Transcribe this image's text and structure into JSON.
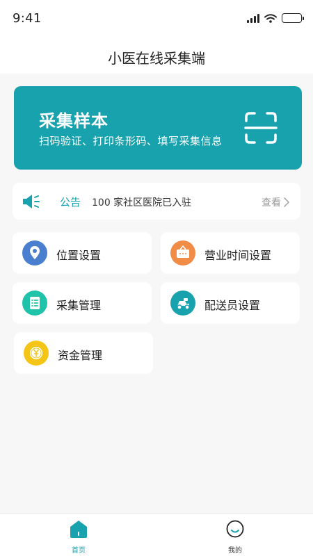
{
  "status_bar": {
    "time": "9:41"
  },
  "header": {
    "title": "小医在线采集端"
  },
  "banner": {
    "title": "采集样本",
    "subtitle": "扫码验证、打印条形码、填写采集信息",
    "icon": "scan-icon"
  },
  "notice": {
    "tag": "公告",
    "text": "100 家社区医院已入驻",
    "more": "查看",
    "icon": "speaker-icon"
  },
  "menu": [
    {
      "label": "位置设置",
      "icon": "location-pin-icon",
      "color": "#4a7fcf"
    },
    {
      "label": "营业时间设置",
      "icon": "sign-board-icon",
      "color": "#f08c45"
    },
    {
      "label": "采集管理",
      "icon": "list-icon",
      "color": "#1fc3a9"
    },
    {
      "label": "配送员设置",
      "icon": "scooter-icon",
      "color": "#17a2ae"
    },
    {
      "label": "资金管理",
      "icon": "yen-coin-icon",
      "color": "#f4c516"
    }
  ],
  "tabs": [
    {
      "label": "首页",
      "icon": "home-icon",
      "active": true
    },
    {
      "label": "我的",
      "icon": "profile-icon",
      "active": false
    }
  ],
  "colors": {
    "accent": "#17a2ae",
    "background": "#f7f7f7",
    "muted": "#999999"
  }
}
